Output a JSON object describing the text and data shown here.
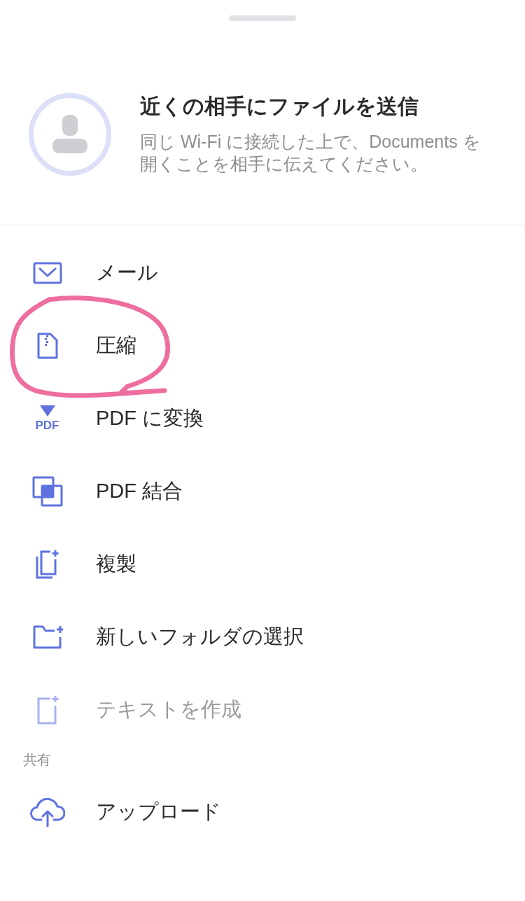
{
  "header": {
    "title": "近くの相手にファイルを送信",
    "description": "同じ Wi-Fi に接続した上で、Documents を開くことを相手に伝えてください。"
  },
  "actions": [
    {
      "label": "メール",
      "kind": "mail",
      "disabled": false
    },
    {
      "label": "圧縮",
      "kind": "zip",
      "disabled": false,
      "annotated": true
    },
    {
      "label": "PDF に変換",
      "kind": "pdf",
      "icon_text": "PDF",
      "disabled": false
    },
    {
      "label": "PDF 結合",
      "kind": "merge",
      "disabled": false
    },
    {
      "label": "複製",
      "kind": "duplicate",
      "disabled": false
    },
    {
      "label": "新しいフォルダの選択",
      "kind": "folder",
      "disabled": false
    },
    {
      "label": "テキストを作成",
      "kind": "newtext",
      "disabled": true
    }
  ],
  "share_section": {
    "heading": "共有",
    "items": [
      {
        "label": "アップロード",
        "kind": "upload",
        "disabled": false
      }
    ]
  }
}
